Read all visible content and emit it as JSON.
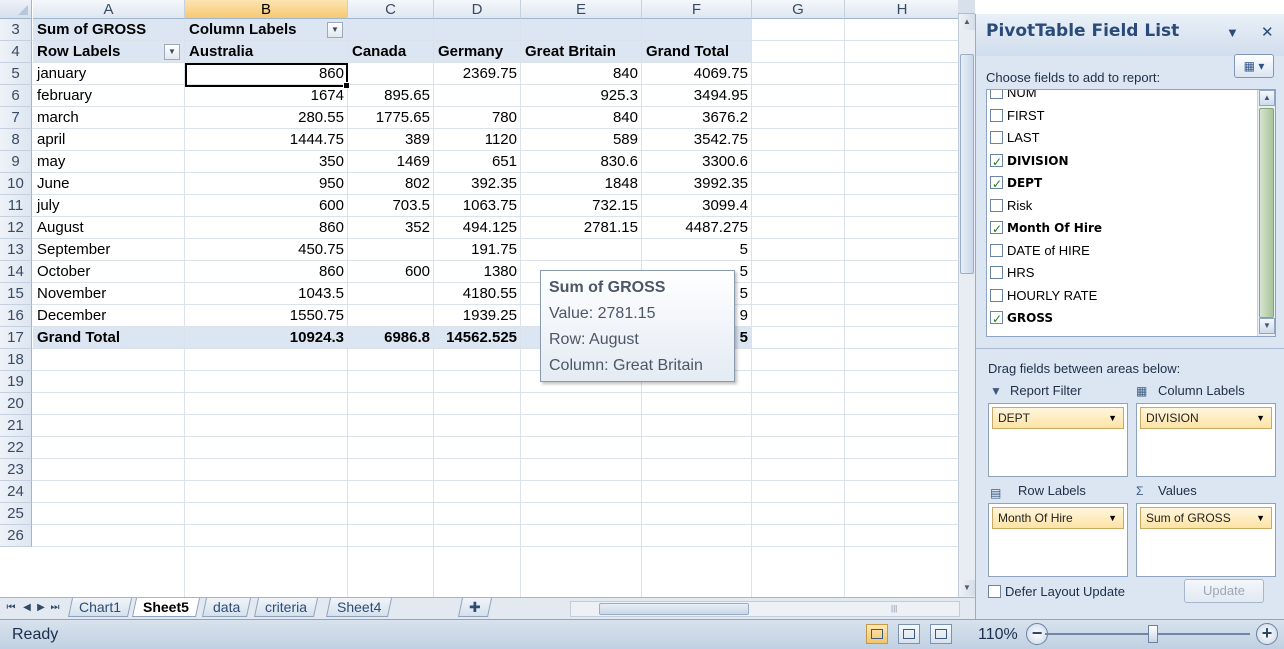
{
  "columns": [
    "A",
    "B",
    "C",
    "D",
    "E",
    "F",
    "G",
    "H"
  ],
  "row_numbers": [
    "3",
    "4",
    "5",
    "6",
    "7",
    "8",
    "9",
    "10",
    "11",
    "12",
    "13",
    "14",
    "15",
    "16",
    "17",
    "18",
    "19",
    "20",
    "21",
    "22",
    "23",
    "24",
    "25",
    "26"
  ],
  "pivot": {
    "r3_a": "Sum of GROSS",
    "r3_b": "Column Labels",
    "row_labels": "Row Labels",
    "headers": [
      "Australia",
      "Canada",
      "Germany",
      "Great Britain",
      "Grand Total"
    ],
    "rows": [
      {
        "label": "january",
        "vals": [
          "860",
          "",
          "2369.75",
          "840",
          "4069.75"
        ]
      },
      {
        "label": "february",
        "vals": [
          "1674",
          "895.65",
          "",
          "925.3",
          "3494.95"
        ]
      },
      {
        "label": "march",
        "vals": [
          "280.55",
          "1775.65",
          "780",
          "840",
          "3676.2"
        ]
      },
      {
        "label": "april",
        "vals": [
          "1444.75",
          "389",
          "1120",
          "589",
          "3542.75"
        ]
      },
      {
        "label": "may",
        "vals": [
          "350",
          "1469",
          "651",
          "830.6",
          "3300.6"
        ]
      },
      {
        "label": "June",
        "vals": [
          "950",
          "802",
          "392.35",
          "1848",
          "3992.35"
        ]
      },
      {
        "label": "july",
        "vals": [
          "600",
          "703.5",
          "1063.75",
          "732.15",
          "3099.4"
        ]
      },
      {
        "label": "August",
        "vals": [
          "860",
          "352",
          "494.125",
          "2781.15",
          "4487.275"
        ]
      },
      {
        "label": "September",
        "vals": [
          "450.75",
          "",
          "191.75",
          "",
          "5"
        ]
      },
      {
        "label": "October",
        "vals": [
          "860",
          "600",
          "1380",
          "",
          "5"
        ]
      },
      {
        "label": "November",
        "vals": [
          "1043.5",
          "",
          "4180.55",
          "",
          "5"
        ]
      },
      {
        "label": "December",
        "vals": [
          "1550.75",
          "",
          "1939.25",
          "",
          "9"
        ]
      }
    ],
    "grand_total": {
      "label": "Grand Total",
      "vals": [
        "10924.3",
        "6986.8",
        "14562.525",
        "",
        "5"
      ]
    }
  },
  "tooltip": {
    "title": "Sum of GROSS",
    "value": "Value: 2781.15",
    "row": "Row: August",
    "column": "Column: Great Britain"
  },
  "sheet_tabs": [
    "Chart1",
    "Sheet5",
    "data",
    "criteria",
    "Sheet4"
  ],
  "active_sheet": "Sheet5",
  "status": "Ready",
  "zoom": "110%",
  "field_list": {
    "title": "PivotTable Field List",
    "choose_label": "Choose fields to add to report:",
    "fields": [
      {
        "name": "NUM",
        "checked": false
      },
      {
        "name": "FIRST",
        "checked": false
      },
      {
        "name": "LAST",
        "checked": false
      },
      {
        "name": "DIVISION",
        "checked": true
      },
      {
        "name": "DEPT",
        "checked": true
      },
      {
        "name": "Risk",
        "checked": false
      },
      {
        "name": "Month Of Hire",
        "checked": true
      },
      {
        "name": "DATE of HIRE",
        "checked": false
      },
      {
        "name": "HRS",
        "checked": false
      },
      {
        "name": "HOURLY RATE",
        "checked": false
      },
      {
        "name": "GROSS",
        "checked": true
      }
    ],
    "drag_label": "Drag fields between areas below:",
    "areas": {
      "report_filter": {
        "label": "Report Filter",
        "item": "DEPT"
      },
      "column_labels": {
        "label": "Column Labels",
        "item": "DIVISION"
      },
      "row_labels": {
        "label": "Row Labels",
        "item": "Month Of Hire"
      },
      "values": {
        "label": "Values",
        "item": "Sum of GROSS"
      }
    },
    "defer_label": "Defer Layout Update",
    "update_label": "Update"
  }
}
